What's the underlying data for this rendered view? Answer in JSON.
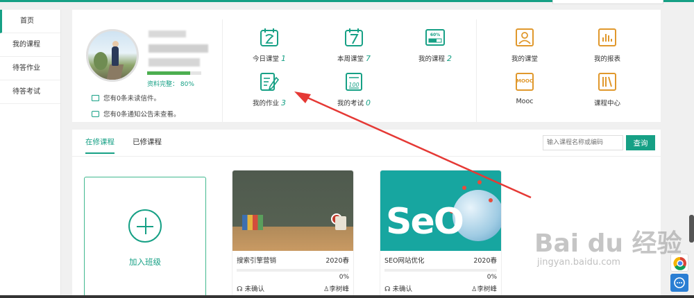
{
  "sidebar": {
    "items": [
      {
        "label": "首页",
        "active": true
      },
      {
        "label": "我的课程",
        "active": false
      },
      {
        "label": "待答作业",
        "active": false
      },
      {
        "label": "待答考试",
        "active": false
      }
    ]
  },
  "profile": {
    "completeness_label": "资料完整：  80%",
    "completeness_percent": 80,
    "messages": [
      "您有0条未读信件。",
      "您有0条通知公告未查看。"
    ]
  },
  "stats": {
    "today_class": {
      "label": "今日课堂",
      "count": "1"
    },
    "week_class": {
      "label": "本周课堂",
      "count": "7"
    },
    "my_courses": {
      "label": "我的课程",
      "count": "2"
    },
    "my_homework": {
      "label": "我的作业",
      "count": "3"
    },
    "my_exams": {
      "label": "我的考试",
      "count": "0"
    }
  },
  "shortcuts": {
    "my_classroom": "我的课堂",
    "my_report": "我的报表",
    "mooc": "Mooc",
    "course_center": "课程中心",
    "mooc_icon_text": "MOOC"
  },
  "courses_panel": {
    "tabs": [
      "在修课程",
      "已修课程"
    ],
    "search_placeholder": "输入课程名称或编码",
    "search_button": "查询",
    "add_class_label": "加入班级",
    "cards": [
      {
        "title": "搜索引擎营销",
        "term": "2020春",
        "progress": "0%",
        "progress_value": 0,
        "status": "未确认",
        "teacher": "李树峰"
      },
      {
        "title": "SEO网站优化",
        "term": "2020春",
        "progress": "0%",
        "progress_value": 0,
        "status": "未确认",
        "teacher": "李树峰"
      }
    ],
    "seo_cover_text": "SeO"
  },
  "watermark": {
    "main": "Bai du 经验",
    "sub": "jingyan.baidu.com"
  },
  "colors": {
    "accent": "#16a085",
    "annotation_arrow": "#e53935"
  }
}
